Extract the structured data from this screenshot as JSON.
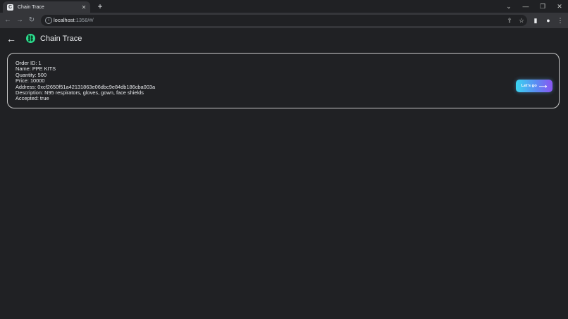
{
  "browser": {
    "tab": {
      "title": "Chain Trace",
      "favicon": "C",
      "close_glyph": "✕"
    },
    "new_tab_glyph": "+",
    "window_controls": {
      "tabsearch": "⌄",
      "minimize": "—",
      "restore": "❐",
      "close": "✕"
    },
    "nav": {
      "back": "←",
      "forward": "→",
      "reload": "↻"
    },
    "address": {
      "host": "localhost",
      "rest": ":1358/#/"
    },
    "icons": {
      "info": "i",
      "share": "⇪",
      "star": "☆",
      "sidepanel": "▮",
      "profile": "●",
      "menu": "⋮"
    }
  },
  "app": {
    "back_glyph": "←",
    "logo_glyph": "⛓",
    "title": "Chain Trace"
  },
  "order": {
    "id": "Order ID: 1",
    "name": "Name: PPE KITS",
    "quantity": "Quantity: 500",
    "price": "Price: 10000",
    "address": "Address: 0xcf2650f51a42131863e06dbc9e84db186cba003a",
    "description": "Description: N95 respirators, gloves, gown, face shields",
    "accepted": "Accepted: true"
  },
  "action": {
    "label": "Let's go",
    "arrow": "⟶"
  },
  "colors": {
    "accent": "#2ddf8f",
    "button_start": "#3ad5f0",
    "button_end": "#8a55f2",
    "background": "#202124"
  }
}
